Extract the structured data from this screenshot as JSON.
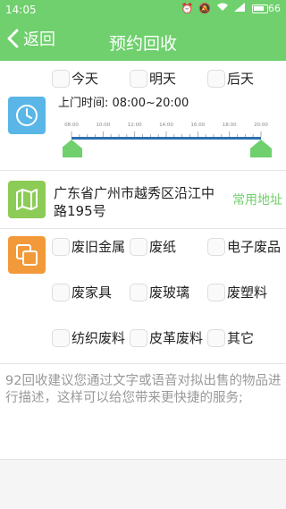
{
  "status_bar": {
    "time": "14:05",
    "battery": "66"
  },
  "header": {
    "back_label": "返回",
    "title": "预约回收"
  },
  "day_options": [
    "今天",
    "明天",
    "后天"
  ],
  "time_section": {
    "hours_label": "上门时间: 08:00~20:00",
    "ticks": [
      "08:00",
      "10:00",
      "12:00",
      "14:00",
      "16:00",
      "18:00",
      "20:00"
    ],
    "range_start_hour": 8,
    "range_end_hour": 20
  },
  "address_section": {
    "address": "广东省广州市越秀区沿江中路195号",
    "link_label": "常用地址"
  },
  "waste_options": [
    "废旧金属",
    "废纸",
    "电子废品",
    "废家具",
    "废玻璃",
    "废塑料",
    "纺织废料",
    "皮革废料",
    "其它"
  ],
  "note": "92回收建议您通过文字或语音对拟出售的物品进行描述，这样可以给您带来更快捷的服务;",
  "colors": {
    "accent": "#6fd06d",
    "clock_bg": "#5bb6e8",
    "map_bg": "#8ccc56",
    "box_bg": "#f29a3a"
  },
  "icons": {
    "back": "chevron-left-icon",
    "clock": "clock-icon",
    "map": "map-icon",
    "category": "copy-icon"
  }
}
